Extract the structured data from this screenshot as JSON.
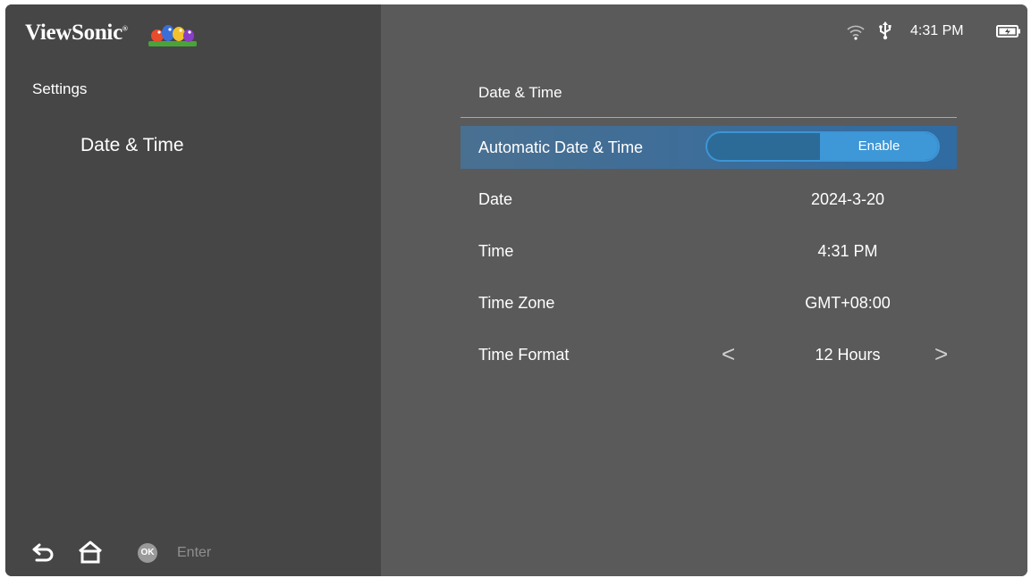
{
  "brand": {
    "logo_text": "ViewSonic",
    "registered_mark": "®"
  },
  "status_bar": {
    "time": "4:31 PM",
    "icons": [
      "wifi-icon",
      "usb-icon",
      "battery-icon"
    ]
  },
  "sidebar": {
    "title": "Settings",
    "items": [
      {
        "label": "Date & Time"
      }
    ]
  },
  "bottom_bar": {
    "ok_badge": "OK",
    "enter_label": "Enter",
    "icons": [
      "back-icon",
      "home-icon"
    ]
  },
  "main": {
    "title": "Date & Time",
    "rows": [
      {
        "label": "Automatic Date & Time",
        "value": "Enable",
        "control": "toggle",
        "selected": true
      },
      {
        "label": "Date",
        "value": "2024-3-20"
      },
      {
        "label": "Time",
        "value": "4:31 PM"
      },
      {
        "label": "Time Zone",
        "value": "GMT+08:00"
      },
      {
        "label": "Time Format",
        "value": "12 Hours",
        "control": "selector",
        "prev_arrow": "<",
        "next_arrow": ">"
      }
    ]
  },
  "colors": {
    "sidebar_bg": "#464646",
    "main_bg": "#5a5a5a",
    "accent": "#3e97d6"
  }
}
